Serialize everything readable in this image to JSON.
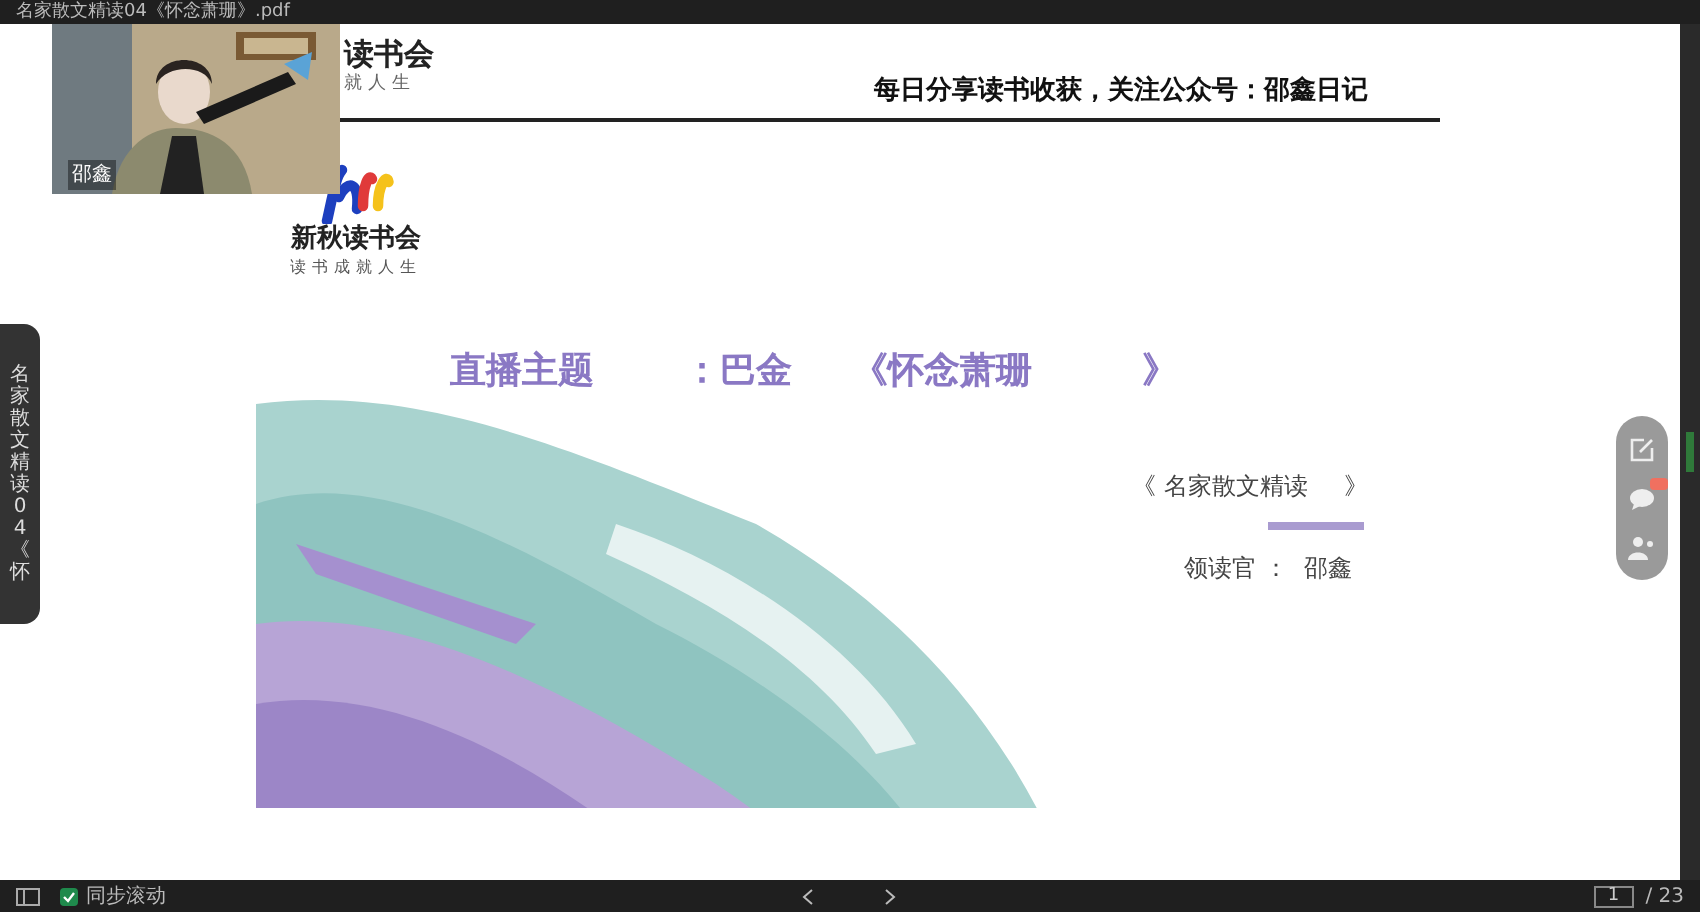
{
  "window": {
    "title": "名家散文精读04《怀念萧珊》.pdf"
  },
  "side_tab": {
    "label": "名家散文精读04《怀"
  },
  "video": {
    "kind": "picture",
    "name": "邵鑫"
  },
  "slide": {
    "logo_top": {
      "name": "读书会",
      "slogan": "就人生"
    },
    "header": "每日分享读书收获，关注公众号：邵鑫日记",
    "logo": {
      "name": "新秋读书会",
      "slogan": "读书成就人生"
    },
    "title_parts": [
      "直播主题",
      "：巴金",
      "《怀念萧珊",
      "》"
    ],
    "series": [
      "《 名家散文精读",
      "》"
    ],
    "reader": [
      "领读官 ：",
      "邵鑫"
    ]
  },
  "bottom_bar": {
    "sync_scroll": {
      "label": "同步滚动",
      "checked": true
    },
    "page": "1",
    "total": "/ 23"
  }
}
